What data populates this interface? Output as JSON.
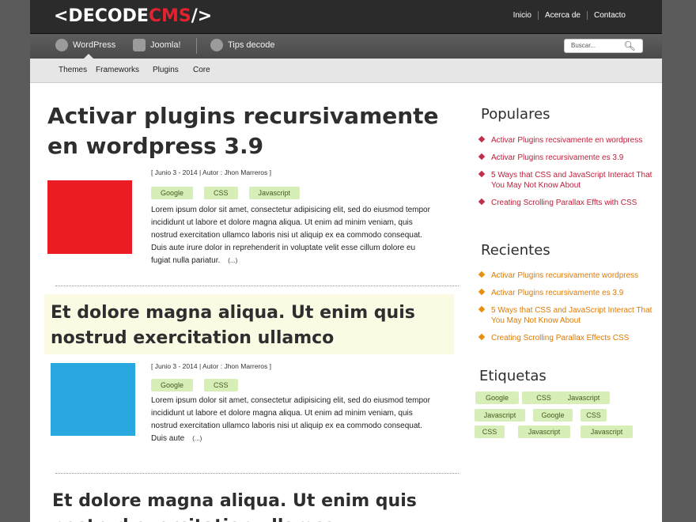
{
  "header": {
    "logo_left": "<DECODE",
    "logo_cms": "CMS",
    "logo_right": "/>",
    "topnav": [
      "Inicio",
      "Acerca de",
      "Contacto"
    ]
  },
  "nav": {
    "items": [
      {
        "label": "WordPress",
        "icon": "wordpress-icon"
      },
      {
        "label": "Joomla!",
        "icon": "joomla-icon"
      },
      {
        "label": "Tips decode",
        "icon": "gear-icon"
      }
    ],
    "search_placeholder": "Buscar..."
  },
  "subnav": [
    "Themes",
    "Frameworks",
    "Plugins",
    "Core"
  ],
  "posts": [
    {
      "title": "Activar plugins recursivamente en wordpress 3.9",
      "meta": "[ Junio 3 - 2014  |  Autor : Jhon Marreros ]",
      "tags": [
        "Google",
        "CSS",
        "Javascript"
      ],
      "excerpt": "Lorem ipsum dolor sit amet, consectetur adipisicing elit, sed do eiusmod tempor incididunt ut labore et dolore magna aliqua. Ut enim ad minim veniam, quis nostrud exercitation ullamco laboris nisi ut aliquip ex ea commodo consequat. Duis aute irure dolor in reprehenderit in voluptate velit esse cillum dolore eu fugiat nulla pariatur.",
      "more": "(...)",
      "thumb_color": "#ec1c24"
    },
    {
      "title": "Et dolore magna aliqua. Ut enim quis nostrud exercitation ullamco",
      "meta": "[ Junio 3 - 2014  |  Autor : Jhon Marreros ]",
      "tags": [
        "Google",
        "CSS"
      ],
      "excerpt": "Lorem ipsum dolor sit amet, consectetur adipisicing elit, sed do eiusmod tempor incididunt ut labore et dolore magna aliqua. Ut enim ad minim veniam, quis nostrud exercitation ullamco laboris nisi ut aliquip ex ea commodo consequat. Duis aute",
      "more": "(...)",
      "thumb_color": "#29a8e0"
    },
    {
      "title": "Et dolore magna aliqua. Ut enim quis nostrud exercitation ullamco"
    }
  ],
  "sidebar": {
    "populares_title": "Populares",
    "populares": [
      "Activar Plugins recsivamente en wordpress",
      "Activar Plugins recursivamente es 3.9",
      "5 Ways that CSS and JavaScript Interact That You May Not Know About",
      "Creating Scrolling Parallax Effts with CSS"
    ],
    "recientes_title": "Recientes",
    "recientes": [
      "Activar Plugins recursivamente wordpress",
      "Activar Plugins recursivamente es 3.9",
      "5 Ways that CSS and JavaScript Interact That You May Not Know About",
      "Creating Scrolling Parallax Effects CSS"
    ],
    "etiquetas_title": "Etiquetas",
    "etiquetas": [
      "Google",
      "CSS",
      "Javascript",
      "Javascript",
      "Google",
      "CSS",
      "CSS",
      "Javascript",
      "Javascript"
    ]
  }
}
